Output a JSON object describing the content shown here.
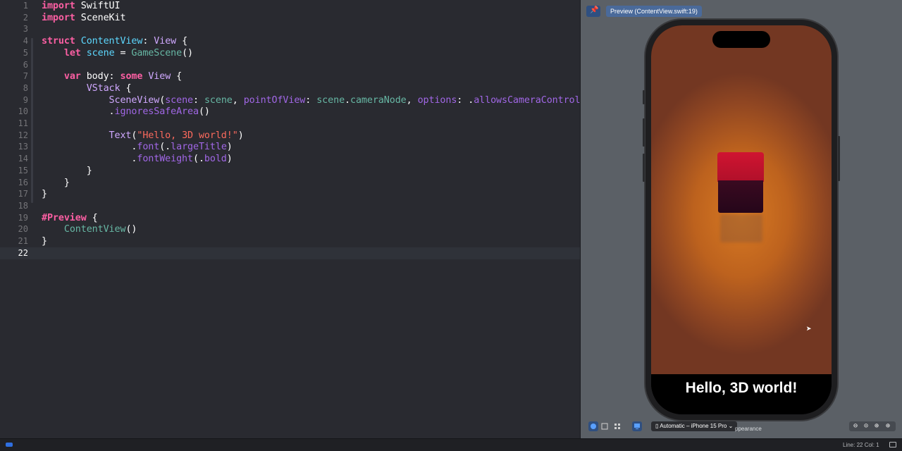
{
  "editor": {
    "lines": [
      {
        "n": "1",
        "tokens": [
          {
            "t": "import",
            "c": "kw"
          },
          {
            "t": " SwiftUI",
            "c": "pl"
          }
        ]
      },
      {
        "n": "2",
        "tokens": [
          {
            "t": "import",
            "c": "kw"
          },
          {
            "t": " SceneKit",
            "c": "pl"
          }
        ]
      },
      {
        "n": "3",
        "tokens": []
      },
      {
        "n": "4",
        "tokens": [
          {
            "t": "struct",
            "c": "kw"
          },
          {
            "t": " ",
            "c": "pl"
          },
          {
            "t": "ContentView",
            "c": "prj"
          },
          {
            "t": ": ",
            "c": "pl"
          },
          {
            "t": "View",
            "c": "ty"
          },
          {
            "t": " {",
            "c": "pl"
          }
        ]
      },
      {
        "n": "5",
        "tokens": [
          {
            "t": "    ",
            "c": "pl"
          },
          {
            "t": "let",
            "c": "kw"
          },
          {
            "t": " ",
            "c": "pl"
          },
          {
            "t": "scene",
            "c": "prj"
          },
          {
            "t": " = ",
            "c": "pl"
          },
          {
            "t": "GameScene",
            "c": "fn"
          },
          {
            "t": "()",
            "c": "pl"
          }
        ]
      },
      {
        "n": "6",
        "tokens": []
      },
      {
        "n": "7",
        "tokens": [
          {
            "t": "    ",
            "c": "pl"
          },
          {
            "t": "var",
            "c": "kw"
          },
          {
            "t": " body: ",
            "c": "pl"
          },
          {
            "t": "some",
            "c": "kw"
          },
          {
            "t": " ",
            "c": "pl"
          },
          {
            "t": "View",
            "c": "ty"
          },
          {
            "t": " {",
            "c": "pl"
          }
        ]
      },
      {
        "n": "8",
        "tokens": [
          {
            "t": "        ",
            "c": "pl"
          },
          {
            "t": "VStack",
            "c": "ty"
          },
          {
            "t": " {",
            "c": "pl"
          }
        ]
      },
      {
        "n": "9",
        "tokens": [
          {
            "t": "            ",
            "c": "pl"
          },
          {
            "t": "SceneView",
            "c": "ty"
          },
          {
            "t": "(",
            "c": "pl"
          },
          {
            "t": "scene",
            "c": "pr"
          },
          {
            "t": ": ",
            "c": "pl"
          },
          {
            "t": "scene",
            "c": "fn"
          },
          {
            "t": ", ",
            "c": "pl"
          },
          {
            "t": "pointOfView",
            "c": "pr"
          },
          {
            "t": ": ",
            "c": "pl"
          },
          {
            "t": "scene",
            "c": "fn"
          },
          {
            "t": ".",
            "c": "pl"
          },
          {
            "t": "cameraNode",
            "c": "fn"
          },
          {
            "t": ", ",
            "c": "pl"
          },
          {
            "t": "options",
            "c": "pr"
          },
          {
            "t": ": .",
            "c": "pl"
          },
          {
            "t": "allowsCameraControl",
            "c": "pr"
          },
          {
            "t": ")",
            "c": "pl"
          }
        ]
      },
      {
        "n": "10",
        "tokens": [
          {
            "t": "            .",
            "c": "pl"
          },
          {
            "t": "ignoresSafeArea",
            "c": "pr"
          },
          {
            "t": "()",
            "c": "pl"
          }
        ]
      },
      {
        "n": "11",
        "tokens": []
      },
      {
        "n": "12",
        "tokens": [
          {
            "t": "            ",
            "c": "pl"
          },
          {
            "t": "Text",
            "c": "ty"
          },
          {
            "t": "(",
            "c": "pl"
          },
          {
            "t": "\"Hello, 3D world!\"",
            "c": "st"
          },
          {
            "t": ")",
            "c": "pl"
          }
        ]
      },
      {
        "n": "13",
        "tokens": [
          {
            "t": "                .",
            "c": "pl"
          },
          {
            "t": "font",
            "c": "pr"
          },
          {
            "t": "(.",
            "c": "pl"
          },
          {
            "t": "largeTitle",
            "c": "pr"
          },
          {
            "t": ")",
            "c": "pl"
          }
        ]
      },
      {
        "n": "14",
        "tokens": [
          {
            "t": "                .",
            "c": "pl"
          },
          {
            "t": "fontWeight",
            "c": "pr"
          },
          {
            "t": "(.",
            "c": "pl"
          },
          {
            "t": "bold",
            "c": "pr"
          },
          {
            "t": ")",
            "c": "pl"
          }
        ]
      },
      {
        "n": "15",
        "tokens": [
          {
            "t": "        }",
            "c": "pl"
          }
        ]
      },
      {
        "n": "16",
        "tokens": [
          {
            "t": "    }",
            "c": "pl"
          }
        ]
      },
      {
        "n": "17",
        "tokens": [
          {
            "t": "}",
            "c": "pl"
          }
        ]
      },
      {
        "n": "18",
        "tokens": []
      },
      {
        "n": "19",
        "tokens": [
          {
            "t": "#Preview",
            "c": "kw"
          },
          {
            "t": " {",
            "c": "pl"
          }
        ]
      },
      {
        "n": "20",
        "tokens": [
          {
            "t": "    ",
            "c": "pl"
          },
          {
            "t": "ContentView",
            "c": "fn"
          },
          {
            "t": "()",
            "c": "pl"
          }
        ]
      },
      {
        "n": "21",
        "tokens": [
          {
            "t": "}",
            "c": "pl"
          }
        ]
      },
      {
        "n": "22",
        "tokens": []
      }
    ],
    "current_line": "22"
  },
  "preview": {
    "chip_label": "Preview (ContentView.swift:19)",
    "pin_icon": "pin-icon"
  },
  "device": {
    "screen_text": "Hello, 3D world!"
  },
  "canvas_toolbar": {
    "device_label": "Automatic – iPhone 15 Pro",
    "appearance_label": "ppearance"
  },
  "statusbar": {
    "line_col": "Line: 22  Col: 1"
  },
  "colors": {
    "editor_bg": "#292a30",
    "keyword": "#fc5fa3",
    "type": "#d0a8ff",
    "project_type": "#5dd8ff",
    "function": "#67b7a4",
    "property": "#a167e6",
    "string": "#fc6a5d",
    "canvas_bg": "#5b6066",
    "cube_red": "#d01431"
  }
}
